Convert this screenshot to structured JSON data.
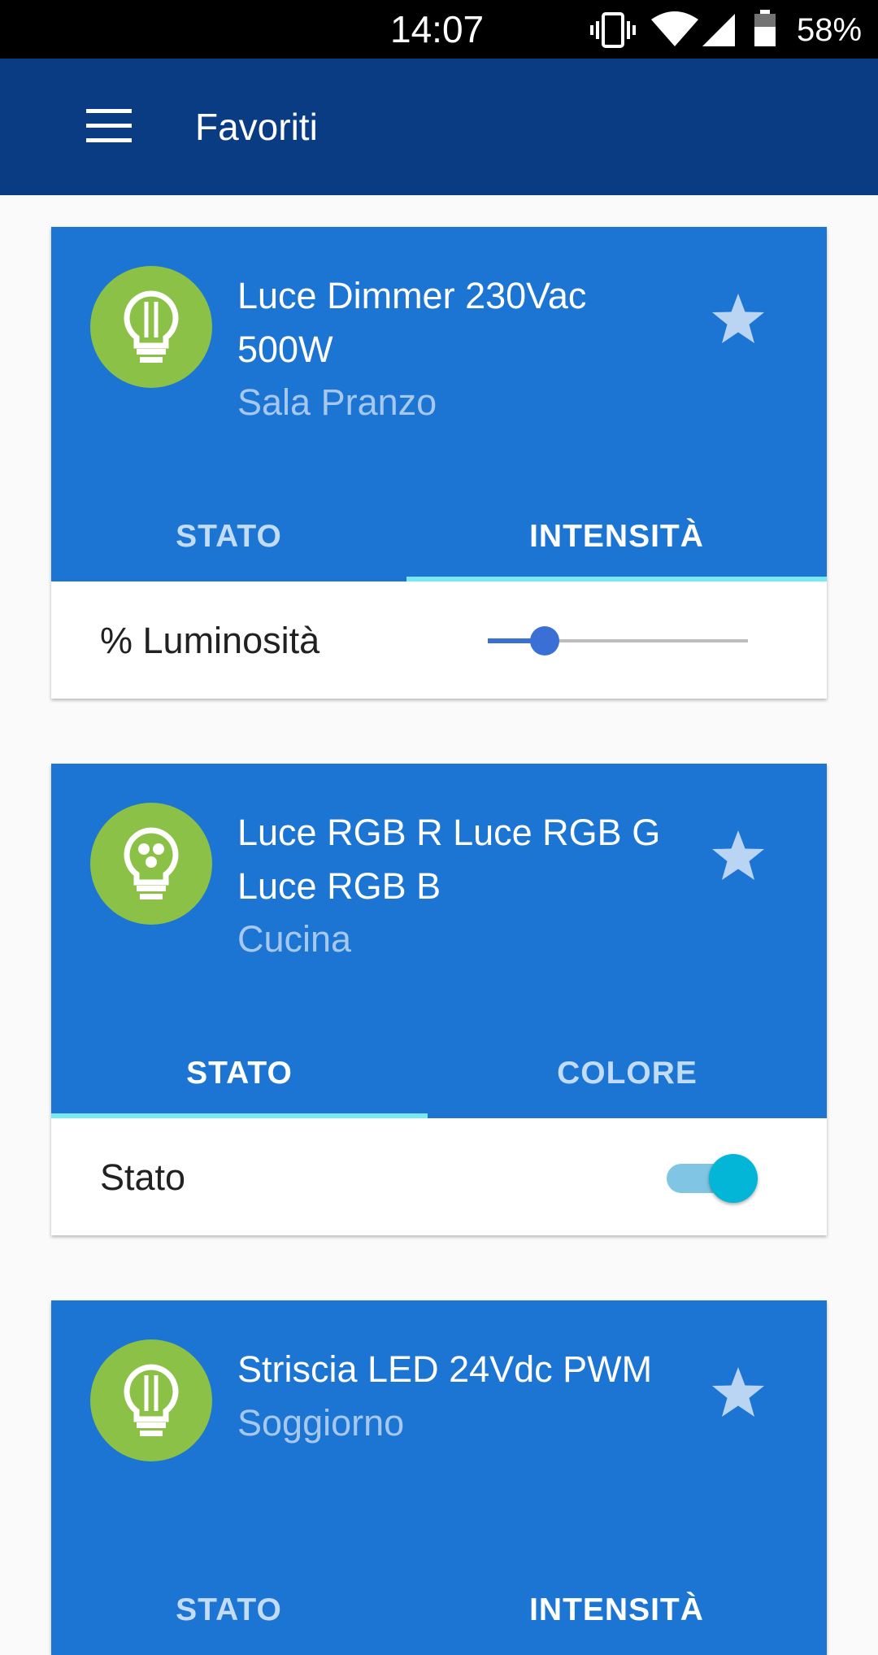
{
  "status_bar": {
    "time": "14:07",
    "battery": "58%",
    "icons": [
      "vibrate-icon",
      "wifi-icon",
      "signal-icon",
      "battery-icon"
    ]
  },
  "app_bar": {
    "title": "Favoriti",
    "menu_icon": "menu-icon"
  },
  "colors": {
    "app_bar": "#0a3c84",
    "card_header": "#1c75d2",
    "bulb_circle": "#8cc147",
    "tab_indicator": "#76e8f6",
    "slider_active": "#3a6fd6",
    "toggle_thumb": "#03b5d6"
  },
  "cards": [
    {
      "title_line1": "Luce Dimmer 230Vac",
      "title_line2": "500W",
      "room": "Sala Pranzo",
      "icon": "bulb-dimmer-icon",
      "favorite": true,
      "tabs": [
        {
          "label": "STATO",
          "active": false
        },
        {
          "label": "INTENSITÀ",
          "active": true
        }
      ],
      "body_label": "% Luminosità",
      "brightness_fraction": 0.22
    },
    {
      "title_line1": "Luce RGB R Luce RGB G",
      "title_line2": "Luce RGB B",
      "room": "Cucina",
      "icon": "bulb-rgb-icon",
      "favorite": true,
      "tabs": [
        {
          "label": "STATO",
          "active": true
        },
        {
          "label": "COLORE",
          "active": false
        }
      ],
      "body_label": "Stato",
      "switch_on": true
    },
    {
      "title_line1": "Striscia LED 24Vdc PWM",
      "room": "Soggiorno",
      "icon": "bulb-dimmer-icon",
      "favorite": true,
      "tabs": [
        {
          "label": "STATO",
          "active": false
        },
        {
          "label": "INTENSITÀ",
          "active": true
        }
      ]
    }
  ]
}
